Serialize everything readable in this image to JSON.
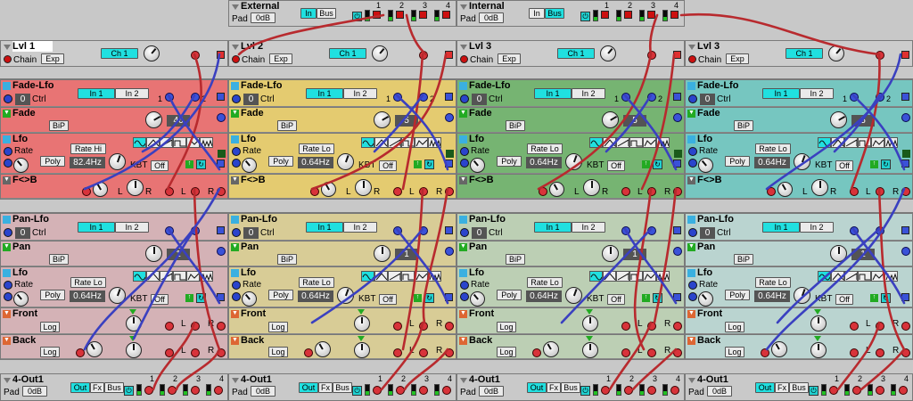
{
  "io_top": [
    {
      "title": "External",
      "pad": "Pad",
      "pad_value": "0dB",
      "btn1": "In",
      "btn2": "Bus",
      "active": 1,
      "ports": [
        "1",
        "2",
        "3",
        "4"
      ]
    },
    {
      "title": "Internal",
      "pad": "Pad",
      "pad_value": "0dB",
      "btn1": "In",
      "btn2": "Bus",
      "active": 2,
      "ports": [
        "1",
        "2",
        "3",
        "4"
      ]
    }
  ],
  "levels": [
    {
      "title": "Lvl 1",
      "chain": "Chain",
      "mode": "Exp",
      "channel": "Ch 1"
    },
    {
      "title": "Lvl 2",
      "chain": "Chain",
      "mode": "Exp",
      "channel": "Ch 1"
    },
    {
      "title": "Lvl 3",
      "chain": "Chain",
      "mode": "Exp",
      "channel": "Ch 1"
    },
    {
      "title": "Lvl 3",
      "chain": "Chain",
      "mode": "Exp",
      "channel": "Ch 1"
    }
  ],
  "fade_columns": [
    {
      "color": "#e87474",
      "title": "Fade-Lfo",
      "ctrl_value": "0",
      "ctrl_label": "Ctrl",
      "in1": "In 1",
      "in2": "In 2",
      "fade_label": "Fade",
      "bip": "BiP",
      "fade_value": "46",
      "lfo_label": "Lfo",
      "rate_label": "Rate",
      "rate_mode": "Rate Hi",
      "poly": "Poly",
      "rate_value": "82.4Hz",
      "kbt": "KBT",
      "off": "Off",
      "fb_label": "F<>B",
      "l": "L",
      "r": "R"
    },
    {
      "color": "#e4cb70",
      "title": "Fade-Lfo",
      "ctrl_value": "0",
      "ctrl_label": "Ctrl",
      "in1": "In 1",
      "in2": "In 2",
      "fade_label": "Fade",
      "bip": "BiP",
      "fade_value": "5",
      "lfo_label": "Lfo",
      "rate_label": "Rate",
      "rate_mode": "Rate Lo",
      "poly": "Poly",
      "rate_value": "0.64Hz",
      "kbt": "KBT",
      "off": "Off",
      "fb_label": "F<>B",
      "l": "L",
      "r": "R"
    },
    {
      "color": "#76b472",
      "title": "Fade-Lfo",
      "ctrl_value": "0",
      "ctrl_label": "Ctrl",
      "in1": "In 1",
      "in2": "In 2",
      "fade_label": "Fade",
      "bip": "BiP",
      "fade_value": "5",
      "lfo_label": "Lfo",
      "rate_label": "Rate",
      "rate_mode": "Rate Lo",
      "poly": "Poly",
      "rate_value": "0.64Hz",
      "kbt": "KBT",
      "off": "Off",
      "fb_label": "F<>B",
      "l": "L",
      "r": "R"
    },
    {
      "color": "#76c6c0",
      "title": "Fade-Lfo",
      "ctrl_value": "0",
      "ctrl_label": "Ctrl",
      "in1": "In 1",
      "in2": "In 2",
      "fade_label": "Fade",
      "bip": "BiP",
      "fade_value": "5",
      "lfo_label": "Lfo",
      "rate_label": "Rate",
      "rate_mode": "Rate Lo",
      "poly": "Poly",
      "rate_value": "0.64Hz",
      "kbt": "KBT",
      "off": "Off",
      "fb_label": "F<>B",
      "l": "L",
      "r": "R"
    }
  ],
  "pan_columns": [
    {
      "color": "#d4b2b6",
      "title": "Pan-Lfo",
      "ctrl_value": "0",
      "ctrl_label": "Ctrl",
      "in1": "In 1",
      "in2": "In 2",
      "pan_label": "Pan",
      "bip": "BiP",
      "pan_value": "1",
      "lfo_label": "Lfo",
      "rate_label": "Rate",
      "rate_mode": "Rate Lo",
      "poly": "Poly",
      "rate_value": "0.64Hz",
      "kbt": "KBT",
      "off": "Off",
      "front_label": "Front",
      "front_mode": "Log",
      "back_label": "Back",
      "back_mode": "Log",
      "l": "L",
      "r": "R"
    },
    {
      "color": "#d8cc96",
      "title": "Pan-Lfo",
      "ctrl_value": "0",
      "ctrl_label": "Ctrl",
      "in1": "In 1",
      "in2": "In 2",
      "pan_label": "Pan",
      "bip": "BiP",
      "pan_value": "1",
      "lfo_label": "Lfo",
      "rate_label": "Rate",
      "rate_mode": "Rate Lo",
      "poly": "Poly",
      "rate_value": "0.64Hz",
      "kbt": "KBT",
      "off": "Off",
      "front_label": "Front",
      "front_mode": "Log",
      "back_label": "Back",
      "back_mode": "Log",
      "l": "L",
      "r": "R"
    },
    {
      "color": "#bccfb4",
      "title": "Pan-Lfo",
      "ctrl_value": "0",
      "ctrl_label": "Ctrl",
      "in1": "In 1",
      "in2": "In 2",
      "pan_label": "Pan",
      "bip": "BiP",
      "pan_value": "1",
      "lfo_label": "Lfo",
      "rate_label": "Rate",
      "rate_mode": "Rate Lo",
      "poly": "Poly",
      "rate_value": "0.64Hz",
      "kbt": "KBT",
      "off": "Off",
      "front_label": "Front",
      "front_mode": "Log",
      "back_label": "Back",
      "back_mode": "Log",
      "l": "L",
      "r": "R"
    },
    {
      "color": "#bad4d0",
      "title": "Pan-Lfo",
      "ctrl_value": "0",
      "ctrl_label": "Ctrl",
      "in1": "In 1",
      "in2": "In 2",
      "pan_label": "Pan",
      "bip": "BiP",
      "pan_value": "1",
      "lfo_label": "Lfo",
      "rate_label": "Rate",
      "rate_mode": "Rate Lo",
      "poly": "Poly",
      "rate_value": "0.64Hz",
      "kbt": "KBT",
      "off": "Off",
      "front_label": "Front",
      "front_mode": "Log",
      "back_label": "Back",
      "back_mode": "Log",
      "l": "L",
      "r": "R"
    }
  ],
  "outputs": [
    {
      "title": "4-Out1",
      "pad": "Pad",
      "pad_value": "0dB",
      "btn1": "Out",
      "btn2": "Fx",
      "btn3": "Bus",
      "ports": [
        "1",
        "2",
        "3",
        "4"
      ]
    },
    {
      "title": "4-Out1",
      "pad": "Pad",
      "pad_value": "0dB",
      "btn1": "Out",
      "btn2": "Fx",
      "btn3": "Bus",
      "ports": [
        "1",
        "2",
        "3",
        "4"
      ]
    },
    {
      "title": "4-Out1",
      "pad": "Pad",
      "pad_value": "0dB",
      "btn1": "Out",
      "btn2": "Fx",
      "btn3": "Bus",
      "ports": [
        "1",
        "2",
        "3",
        "4"
      ]
    },
    {
      "title": "4-Out1",
      "pad": "Pad",
      "pad_value": "0dB",
      "btn1": "Out",
      "btn2": "Fx",
      "btn3": "Bus",
      "ports": [
        "1",
        "2",
        "3",
        "4"
      ]
    }
  ],
  "icons": {
    "module_menu": "triangle-down-icon",
    "power": "power-icon",
    "record": "record-dot-icon",
    "square": "square-icon",
    "arrow_up": "arrow-up-icon",
    "cycle": "cycle-icon"
  },
  "colors": {
    "cable_red": "#b82a2e",
    "cable_blue": "#3a40c0",
    "button_on": "#20e0e0",
    "display": "#545454"
  }
}
